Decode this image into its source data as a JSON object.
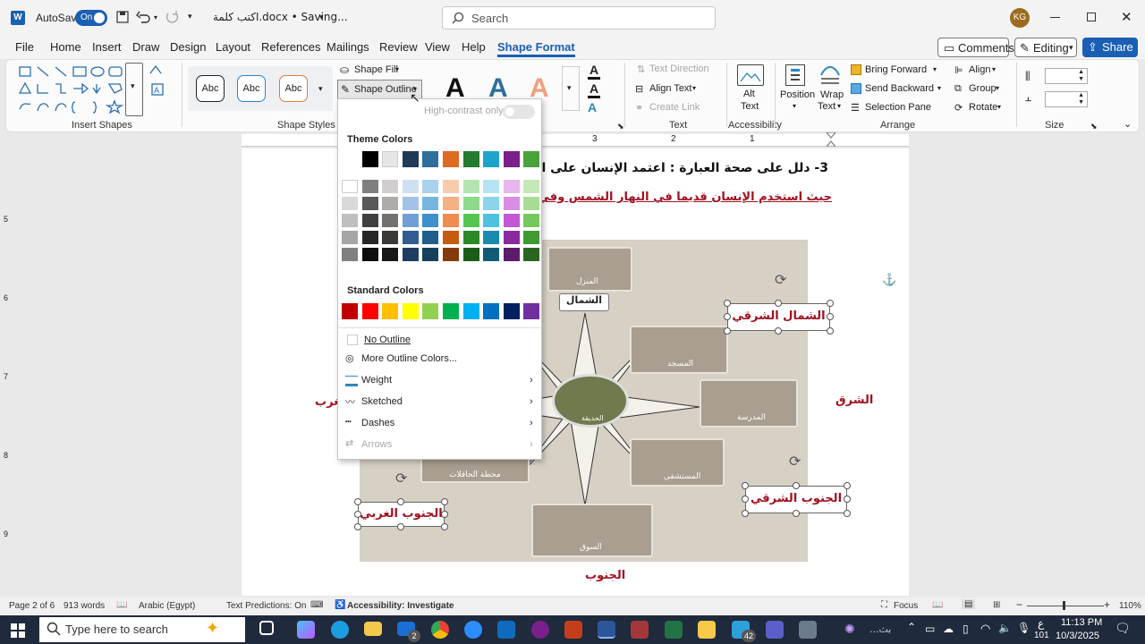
{
  "titlebar": {
    "autosave_label": "AutoSave",
    "autosave_state": "On",
    "doc_title": "اكتب كلمة.docx • Saving...",
    "search_placeholder": "Search",
    "user_initials": "KG"
  },
  "menu": {
    "tabs": [
      "File",
      "Home",
      "Insert",
      "Draw",
      "Design",
      "Layout",
      "References",
      "Mailings",
      "Review",
      "View",
      "Help",
      "Shape Format"
    ],
    "active_tab": "Shape Format",
    "comments": "Comments",
    "editing": "Editing",
    "share": "Share"
  },
  "ribbon": {
    "groups": {
      "insert_shapes": "Insert Shapes",
      "shape_styles": "Shape Styles",
      "text": "Text",
      "accessibility": "Accessibility",
      "arrange": "Arrange",
      "size": "Size"
    },
    "style_sample": "Abc",
    "shape_fill": "Shape Fill",
    "shape_outline": "Shape Outline",
    "wordart_letter": "A",
    "text_direction": "Text Direction",
    "align_text": "Align Text",
    "create_link": "Create Link",
    "alt_text": [
      "Alt",
      "Text"
    ],
    "position": "Position",
    "wrap_text": [
      "Wrap",
      "Text"
    ],
    "bring_forward": "Bring Forward",
    "send_backward": "Send Backward",
    "selection_pane": "Selection Pane",
    "align": "Align",
    "group": "Group",
    "rotate": "Rotate",
    "ruler_numbers": [
      "3",
      "2",
      "1"
    ],
    "vruler_numbers": [
      "5",
      "6",
      "7",
      "8",
      "9"
    ]
  },
  "dropdown": {
    "high_contrast": "High-contrast only",
    "theme_colors_title": "Theme Colors",
    "theme_row": [
      "#000000",
      "#e7e6e6",
      "#1f3b57",
      "#2e6f9b",
      "#dd6b22",
      "#247a2e",
      "#1ea4cc",
      "#7a1f8c",
      "#4aa33a"
    ],
    "tints": [
      [
        "#ffffff",
        "#7f7f7f",
        "#d0cece",
        "#cfe0f2",
        "#a9d2ee",
        "#f8cbad",
        "#b4e5b0",
        "#b6e4f3",
        "#e7b6ef",
        "#c5e8b8"
      ],
      [
        "#d9d9d9",
        "#595959",
        "#aeabab",
        "#a4c2e6",
        "#77b6df",
        "#f4b183",
        "#8fd98a",
        "#8ad5ec",
        "#d88ee3",
        "#a8dc94"
      ],
      [
        "#bfbfbf",
        "#404040",
        "#757070",
        "#6f9fd4",
        "#3f8fc9",
        "#ef8c4f",
        "#55c450",
        "#4dc1e0",
        "#c157d3",
        "#77c85c"
      ],
      [
        "#a6a6a6",
        "#262626",
        "#3b3838",
        "#2f5d91",
        "#215f8a",
        "#c55a11",
        "#2a8a27",
        "#1a8bae",
        "#8b2aa0",
        "#3f9a32"
      ],
      [
        "#808080",
        "#0d0d0d",
        "#181717",
        "#1f3d61",
        "#163f5c",
        "#843c0c",
        "#1c5c1a",
        "#115c74",
        "#5c1c6b",
        "#2a6621"
      ]
    ],
    "standard_colors_title": "Standard Colors",
    "standard_row": [
      "#c00000",
      "#ff0000",
      "#ffc000",
      "#ffff00",
      "#92d050",
      "#00b050",
      "#00b0f0",
      "#0070c0",
      "#002060",
      "#7030a0"
    ],
    "no_outline": "No Outline",
    "more_colors": "More Outline Colors...",
    "weight": "Weight",
    "sketched": "Sketched",
    "dashes": "Dashes",
    "arrows": "Arrows"
  },
  "document": {
    "question": "3- دلل على صحة العبارة : اعتمد الإنسان على الطبيعة في تحديد",
    "answer": "حيث استخدم الإنسان قديماً في النهار الشمس وفي الليل النجوم (ال",
    "label_west": "الغرب",
    "label_east": "الشرق",
    "label_south": "الجنوب",
    "label_northeast": "الشمال الشرقي",
    "label_southeast": "الجنوب الشرقي",
    "label_southwest": "الجنوب الغربي",
    "photo_labels": {
      "house": "المنزل",
      "north": "الشمال",
      "mosque": "المسجد",
      "garden": "الحديقة",
      "school": "المدرسة",
      "bus_station": "محطة الحافلات",
      "hospital": "المستشفى",
      "market": "السوق"
    }
  },
  "statusbar": {
    "page": "Page 2 of 6",
    "words": "913 words",
    "language": "Arabic (Egypt)",
    "predictions": "Text Predictions: On",
    "accessibility": "Accessibility: Investigate",
    "focus": "Focus",
    "zoom": "110%"
  },
  "taskbar": {
    "search_placeholder": "Type here to search",
    "mail_badge": "2",
    "badge_42": "42",
    "lang": "ع",
    "lang_sub": "101",
    "time": "11:13 PM",
    "date": "10/3/2025",
    "weather": "بث..."
  }
}
